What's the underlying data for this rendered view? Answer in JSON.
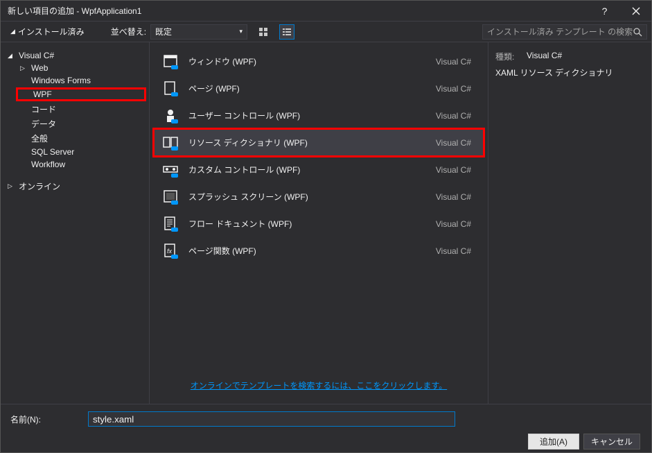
{
  "title": "新しい項目の追加 - WpfApplication1",
  "toolbar": {
    "installed_label": "インストール済み",
    "sort_label": "並べ替え:",
    "sort_value": "既定",
    "search_placeholder": "インストール済み テンプレート の検索 (Ctrl+E)"
  },
  "sidebar": {
    "root": "Visual C#",
    "items": [
      "Web",
      "Windows Forms",
      "WPF",
      "コード",
      "データ",
      "全般",
      "SQL Server",
      "Workflow"
    ],
    "highlighted_index": 2,
    "online": "オンライン"
  },
  "templates": [
    {
      "name": "ウィンドウ (WPF)",
      "lang": "Visual C#"
    },
    {
      "name": "ページ (WPF)",
      "lang": "Visual C#"
    },
    {
      "name": "ユーザー コントロール (WPF)",
      "lang": "Visual C#"
    },
    {
      "name": "リソース ディクショナリ (WPF)",
      "lang": "Visual C#"
    },
    {
      "name": "カスタム コントロール (WPF)",
      "lang": "Visual C#"
    },
    {
      "name": "スプラッシュ スクリーン (WPF)",
      "lang": "Visual C#"
    },
    {
      "name": "フロー ドキュメント (WPF)",
      "lang": "Visual C#"
    },
    {
      "name": "ページ関数 (WPF)",
      "lang": "Visual C#"
    }
  ],
  "selected_index": 3,
  "highlighted_template_index": 3,
  "detail": {
    "type_label": "種類:",
    "type_value": "Visual C#",
    "desc": "XAML リソース ディクショナリ"
  },
  "online_link": "オンラインでテンプレートを検索するには、ここをクリックします。",
  "footer": {
    "name_label": "名前(N):",
    "name_value": "style.xaml",
    "add_button": "追加(A)",
    "cancel_button": "キャンセル"
  }
}
